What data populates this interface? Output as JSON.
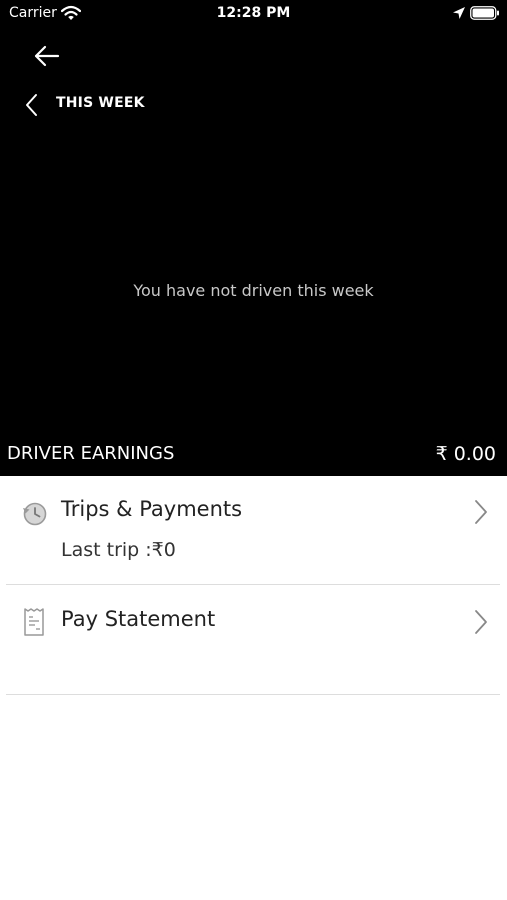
{
  "status_bar": {
    "carrier": "Carrier",
    "time": "12:28 PM"
  },
  "header": {
    "week_label": "THIS WEEK"
  },
  "chart": {
    "empty_message": "You have not driven this week"
  },
  "earnings": {
    "label": "DRIVER EARNINGS",
    "value": "₹ 0.00"
  },
  "menu": {
    "trips": {
      "title": "Trips & Payments",
      "subtitle": "Last trip :₹0",
      "icon": "history-clock-icon"
    },
    "pay_statement": {
      "title": "Pay Statement",
      "icon": "receipt-icon"
    }
  },
  "colors": {
    "header_background": "#000000",
    "page_background": "#ffffff",
    "divider": "#dddddd"
  }
}
